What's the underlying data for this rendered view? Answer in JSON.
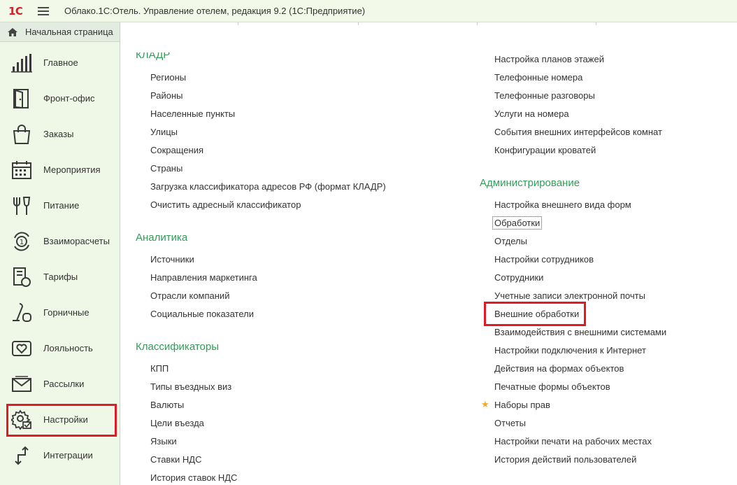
{
  "app": {
    "logo": "1С",
    "title": "Облако.1С:Отель. Управление отелем, редакция 9.2  (1С:Предприятие)"
  },
  "sidebar": {
    "home": "Начальная страница",
    "items": [
      {
        "label": "Главное",
        "icon": "bar-chart-icon"
      },
      {
        "label": "Фронт-офис",
        "icon": "door-icon"
      },
      {
        "label": "Заказы",
        "icon": "shopping-bag-icon"
      },
      {
        "label": "Мероприятия",
        "icon": "calendar-icon"
      },
      {
        "label": "Питание",
        "icon": "fork-glass-icon"
      },
      {
        "label": "Взаиморасчеты",
        "icon": "coin-cycle-icon"
      },
      {
        "label": "Тарифы",
        "icon": "price-tag-icon"
      },
      {
        "label": "Горничные",
        "icon": "vacuum-cleaner-icon"
      },
      {
        "label": "Лояльность",
        "icon": "heart-card-icon"
      },
      {
        "label": "Рассылки",
        "icon": "envelope-icon"
      },
      {
        "label": "Настройки",
        "icon": "gear-icon"
      },
      {
        "label": "Интеграции",
        "icon": "integration-arrows-icon"
      }
    ]
  },
  "main": {
    "left": {
      "kladr": {
        "title": "КЛАДР",
        "items": [
          "Регионы",
          "Районы",
          "Населенные пункты",
          "Улицы",
          "Сокращения",
          "Страны",
          "Загрузка классификатора адресов РФ (формат КЛАДР)",
          "Очистить адресный классификатор"
        ]
      },
      "analytics": {
        "title": "Аналитика",
        "items": [
          "Источники",
          "Направления маркетинга",
          "Отрасли компаний",
          "Социальные показатели"
        ]
      },
      "classifiers": {
        "title": "Классификаторы",
        "items": [
          "КПП",
          "Типы въездных виз",
          "Валюты",
          "Цели въезда",
          "Языки",
          "Ставки НДС",
          "История ставок НДС"
        ]
      }
    },
    "right": {
      "top_items": [
        "Настройка планов этажей",
        "Телефонные номера",
        "Телефонные разговоры",
        "Услуги на номера",
        "События внешних интерфейсов комнат",
        "Конфигурации кроватей"
      ],
      "admin": {
        "title": "Администрирование",
        "items": [
          "Настройка внешнего вида форм",
          "Обработки",
          "Отделы",
          "Настройки сотрудников",
          "Сотрудники",
          "Учетные записи электронной почты",
          "Внешние обработки",
          "Взаимодействия с внешними системами",
          "Настройки подключения к Интернет",
          "Действия на формах объектов",
          "Печатные формы объектов",
          "Наборы прав",
          "Отчеты",
          "Настройки печати на рабочих местах",
          "История действий пользователей"
        ]
      }
    }
  },
  "colors": {
    "accent_green": "#2f9e57",
    "highlight_red": "#e01b24",
    "star": "#f5a623",
    "sidebar_bg": "#eff8e7"
  }
}
